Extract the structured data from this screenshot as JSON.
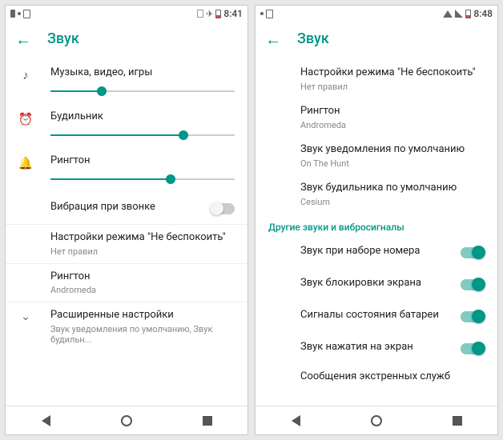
{
  "left": {
    "status_time": "8:41",
    "title": "Звук",
    "sliders": {
      "media": {
        "label": "Музыка, видео, игры",
        "value": 28
      },
      "alarm": {
        "label": "Будильник",
        "value": 72
      },
      "ring": {
        "label": "Рингтон",
        "value": 65
      }
    },
    "vibrate_on_ring": "Вибрация при звонке",
    "dnd": {
      "title": "Настройки режима \"Не беспокоить\"",
      "sub": "Нет правил"
    },
    "ringtone": {
      "title": "Рингтон",
      "sub": "Andromeda"
    },
    "advanced": {
      "title": "Расширенные настройки",
      "sub": "Звук уведомления по умолчанию, Звук будильн..."
    }
  },
  "right": {
    "status_time": "8:48",
    "title": "Звук",
    "dnd": {
      "title": "Настройки режима \"Не беспокоить\"",
      "sub": "Нет правил"
    },
    "ringtone": {
      "title": "Рингтон",
      "sub": "Andromeda"
    },
    "notif_sound": {
      "title": "Звук уведомления по умолчанию",
      "sub": "On The Hunt"
    },
    "alarm_sound": {
      "title": "Звук будильника по умолчанию",
      "sub": "Cesium"
    },
    "section_other": "Другие звуки и вибросигналы",
    "toggles": {
      "dialpad": {
        "label": "Звук при наборе номера",
        "on": true
      },
      "lock": {
        "label": "Звук блокировки экрана",
        "on": true
      },
      "battery": {
        "label": "Сигналы состояния батареи",
        "on": true
      },
      "touch": {
        "label": "Звук нажатия на экран",
        "on": true
      }
    },
    "emergency": "Сообщения экстренных служб"
  }
}
